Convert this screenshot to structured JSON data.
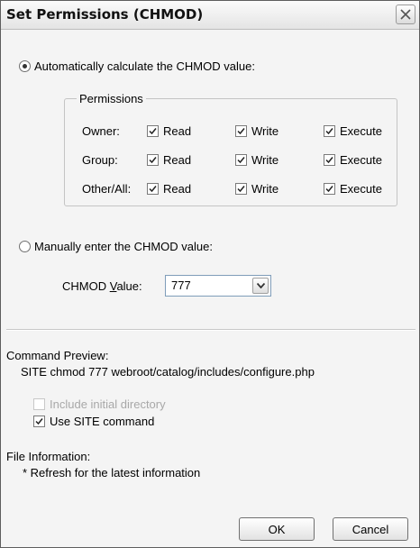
{
  "dialog": {
    "title": "Set Permissions (CHMOD)"
  },
  "auto": {
    "label": "Automatically calculate the CHMOD value:",
    "selected": true
  },
  "permissions": {
    "legend": "Permissions",
    "rows": [
      {
        "label": "Owner:",
        "read": "Read",
        "write": "Write",
        "execute": "Execute"
      },
      {
        "label": "Group:",
        "read": "Read",
        "write": "Write",
        "execute": "Execute"
      },
      {
        "label": "Other/All:",
        "read": "Read",
        "write": "Write",
        "execute": "Execute"
      }
    ]
  },
  "manual": {
    "label": "Manually enter the CHMOD value:",
    "selected": false
  },
  "chmod": {
    "label_pre": "CHMOD ",
    "label_mnemonic": "V",
    "label_post": "alue:",
    "value": "777"
  },
  "preview": {
    "heading": "Command Preview:",
    "command": "SITE chmod 777 webroot/catalog/includes/configure.php",
    "include_initial": "Include initial directory",
    "use_site": "Use SITE command"
  },
  "file_info": {
    "heading": "File Information:",
    "note": "* Refresh for the latest information"
  },
  "buttons": {
    "ok": "OK",
    "cancel": "Cancel"
  },
  "icons": {
    "close": "close-icon",
    "check": "check-icon",
    "dropdown": "chevron-down-icon"
  }
}
